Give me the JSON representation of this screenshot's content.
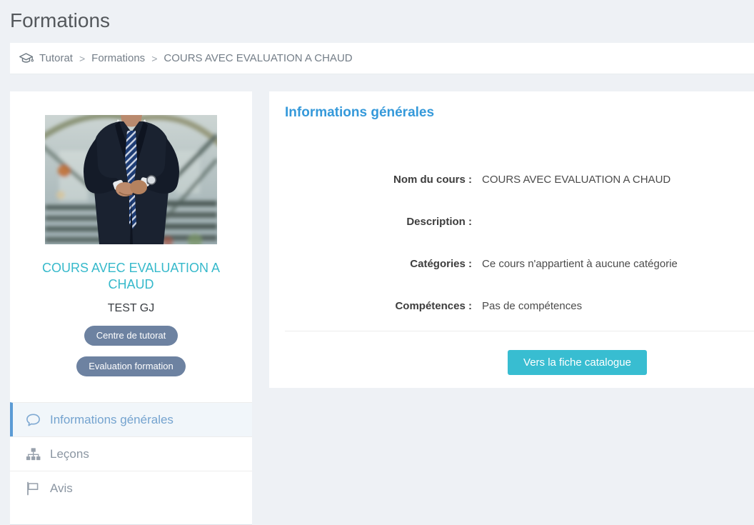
{
  "page": {
    "title": "Formations"
  },
  "breadcrumb": {
    "icon": "graduation-cap-icon",
    "separator": ">",
    "items": [
      "Tutorat",
      "Formations",
      "COURS AVEC EVALUATION A CHAUD"
    ]
  },
  "sidebar": {
    "photo": "businessman-suit-photo",
    "title": "COURS AVEC EVALUATION A CHAUD",
    "subtitle": "TEST GJ",
    "badges": [
      "Centre de tutorat",
      "Evaluation formation"
    ],
    "menu": [
      {
        "icon": "comment-icon",
        "label": "Informations générales",
        "active": true
      },
      {
        "icon": "sitemap-icon",
        "label": "Leçons",
        "active": false
      },
      {
        "icon": "flag-icon",
        "label": "Avis",
        "active": false
      }
    ]
  },
  "main": {
    "heading": "Informations générales",
    "fields": [
      {
        "label": "Nom du cours :",
        "value": "COURS AVEC EVALUATION A CHAUD"
      },
      {
        "label": "Description :",
        "value": ""
      },
      {
        "label": "Catégories :",
        "value": "Ce cours n'appartient à aucune catégorie"
      },
      {
        "label": "Compétences :",
        "value": "Pas de compétences"
      }
    ],
    "action_button": "Vers la fiche catalogue"
  },
  "colors": {
    "accent_teal": "#38bdd1",
    "heading_blue": "#3599da",
    "badge_slate": "#6d82a1",
    "active_item_blue": "#5b9bd5",
    "page_background": "#eef1f5"
  }
}
